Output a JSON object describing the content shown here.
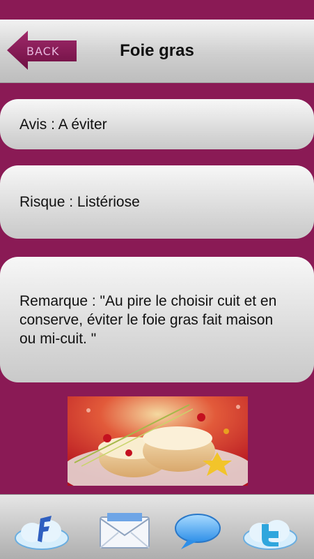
{
  "header": {
    "back_label": "BACK",
    "title": "Foie gras"
  },
  "cards": {
    "avis": "Avis : A éviter",
    "risque": "Risque : Listériose",
    "remarque": "Remarque : \"Au pire le choisir cuit et en conserve, éviter le foie gras fait maison ou mi-cuit. \""
  },
  "toolbar": {
    "items": [
      {
        "icon": "facebook-cloud-icon"
      },
      {
        "icon": "envelope-icon"
      },
      {
        "icon": "speech-bubble-icon"
      },
      {
        "icon": "twitter-cloud-icon"
      }
    ]
  },
  "colors": {
    "background": "#8a1a55",
    "back_arrow": "#8a1a55",
    "back_text": "#e7b8de"
  }
}
